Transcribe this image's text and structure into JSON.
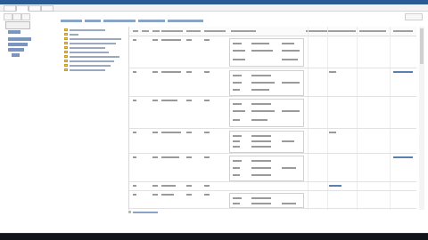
{
  "ribbon": {
    "tabs": [
      "",
      "",
      "",
      ""
    ]
  },
  "breadcrumb": {
    "segments": [
      "",
      "",
      "",
      "",
      ""
    ]
  },
  "nav": {
    "items": [
      {
        "label": ""
      },
      {
        "label": ""
      },
      {
        "label": ""
      },
      {
        "label": ""
      },
      {
        "label": ""
      }
    ]
  },
  "tree": {
    "items": [
      "",
      "",
      "",
      "",
      "",
      "",
      "",
      "",
      "",
      ""
    ]
  },
  "grid": {
    "headers": [
      "",
      "",
      "",
      "",
      "",
      "",
      "",
      "",
      "",
      "",
      ""
    ],
    "rows": [
      {
        "n": "",
        "id": ""
      },
      {
        "n": "",
        "id": ""
      },
      {
        "n": "",
        "id": ""
      },
      {
        "n": "",
        "id": ""
      },
      {
        "n": "",
        "id": ""
      },
      {
        "n": "",
        "id": ""
      },
      {
        "n": "",
        "id": ""
      },
      {
        "n": "",
        "id": ""
      }
    ]
  },
  "footer": {
    "add_label": ""
  },
  "colors": {
    "brand": "#2b5a97",
    "link": "#5c7fb2",
    "folder": "#e8c05a"
  }
}
